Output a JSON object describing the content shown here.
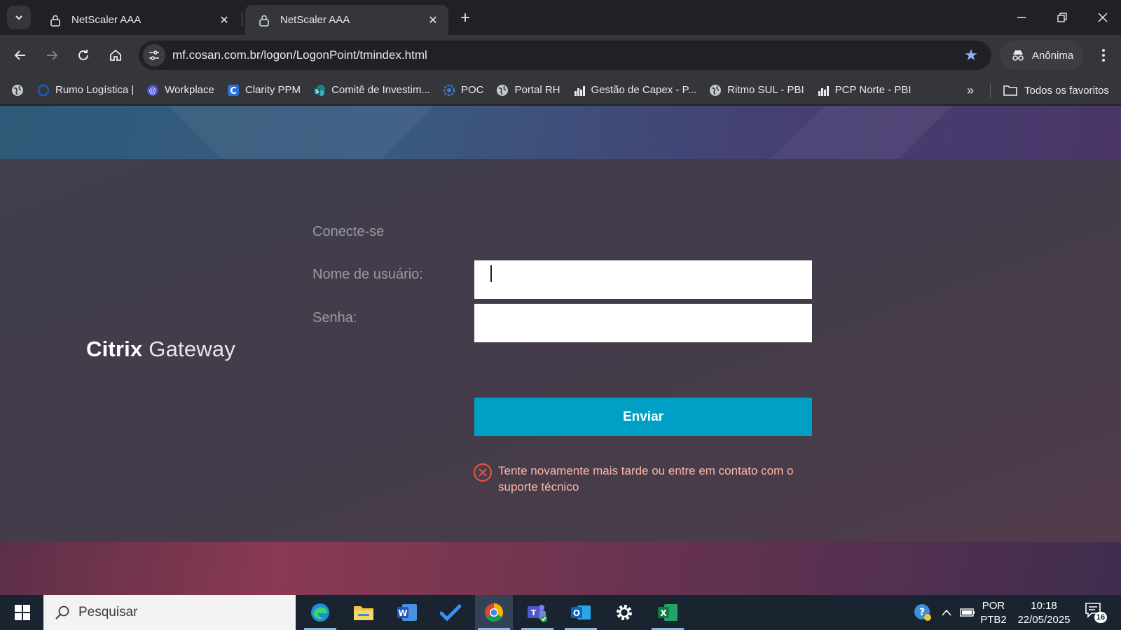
{
  "browser": {
    "tabs": [
      {
        "title": "NetScaler AAA",
        "active": false
      },
      {
        "title": "NetScaler AAA",
        "active": true
      }
    ],
    "new_tab_label": "+",
    "url": "mf.cosan.com.br/logon/LogonPoint/tmindex.html",
    "profile_label": "Anônima",
    "bookmarks": [
      {
        "label": "Rumo Logística |",
        "icon": "rumo-logo-icon"
      },
      {
        "label": "Workplace",
        "icon": "workplace-logo-icon"
      },
      {
        "label": "Clarity PPM",
        "icon": "clarity-logo-icon"
      },
      {
        "label": "Comitê de Investim...",
        "icon": "sharepoint-icon"
      },
      {
        "label": "POC",
        "icon": "gear-globe-icon"
      },
      {
        "label": "Portal RH",
        "icon": "globe-icon"
      },
      {
        "label": "Gestão de Capex - P...",
        "icon": "powerbi-icon"
      },
      {
        "label": "Ritmo SUL - PBI",
        "icon": "globe-icon"
      },
      {
        "label": "PCP Norte - PBI",
        "icon": "powerbi-icon"
      }
    ],
    "all_bookmarks_label": "Todos os favoritos",
    "colors": {
      "accent": "#8ab4f8"
    }
  },
  "login": {
    "brand_bold": "Citrix",
    "brand_light": "Gateway",
    "title": "Conecte-se",
    "username_label": "Nome de usuário:",
    "username_value": "",
    "password_label": "Senha:",
    "password_value": "",
    "submit_label": "Enviar",
    "error_message": "Tente novamente mais tarde ou entre em contato com o suporte técnico",
    "colors": {
      "button": "#00a0c6",
      "error": "#ffb7a6",
      "error_icon": "#e8503a"
    }
  },
  "taskbar": {
    "search_placeholder": "Pesquisar",
    "apps": [
      "edge-icon",
      "file-explorer-icon",
      "word-icon",
      "todo-icon",
      "chrome-icon",
      "teams-icon",
      "outlook-icon",
      "settings-gear-icon",
      "excel-icon"
    ],
    "language_top": "POR",
    "language_bottom": "PTB2",
    "time": "10:18",
    "date": "22/05/2025",
    "notification_count": "16"
  }
}
